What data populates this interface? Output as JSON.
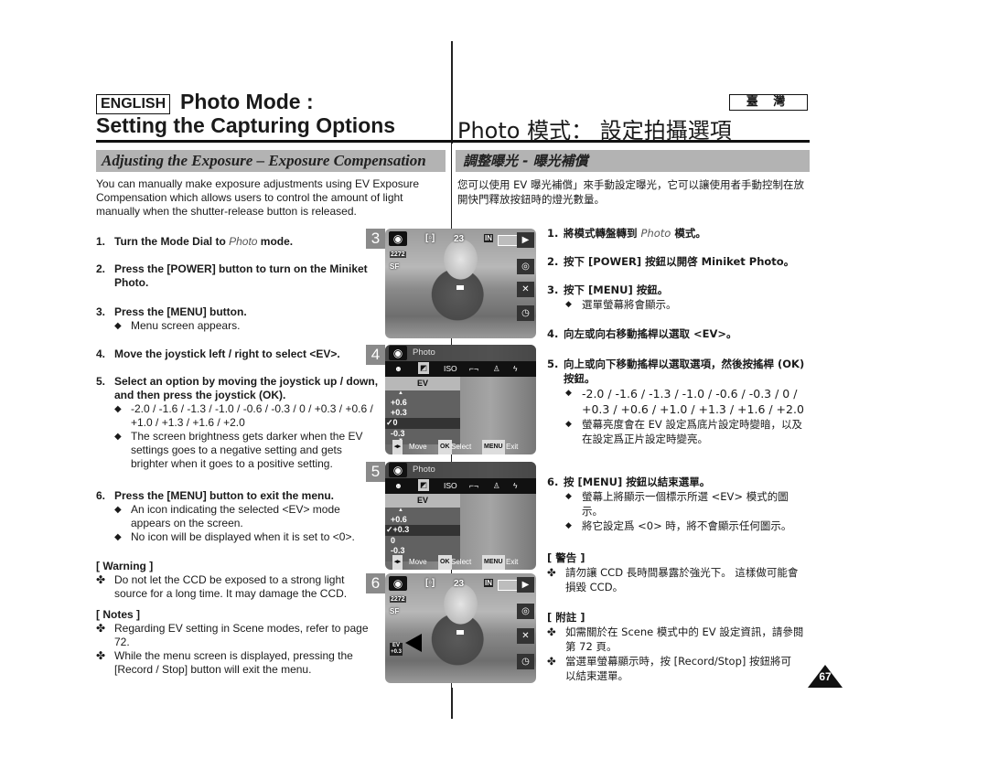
{
  "header": {
    "language_badge": "ENGLISH",
    "title_line1": "Photo Mode :",
    "title_line2": "Setting the Capturing Options",
    "region_badge": "臺 灣",
    "title_zh": "Photo  模式：  設定拍攝選項"
  },
  "section": {
    "title_en": "Adjusting the Exposure – Exposure Compensation",
    "title_zh": "調整曝光 - 曝光補償"
  },
  "english": {
    "intro": "You can manually make exposure adjustments using EV Exposure Compensation which allows users to control the amount of light manually when the shutter-release button is released.",
    "steps": [
      {
        "num": "1.",
        "text_pre": "Turn the Mode Dial to ",
        "text_italic": "Photo",
        "text_post": " mode."
      },
      {
        "num": "2.",
        "text": "Press the [POWER] button to turn on the Miniket Photo."
      },
      {
        "num": "3.",
        "text": "Press the [MENU] button.",
        "subs": [
          "Menu screen appears."
        ]
      },
      {
        "num": "4.",
        "text": "Move the joystick left / right to select <EV>."
      },
      {
        "num": "5.",
        "text": "Select an option by moving the joystick up / down, and then press the joystick (OK).",
        "subs": [
          "-2.0 / -1.6 / -1.3 / -1.0 / -0.6 / -0.3 / 0 / +0.3 / +0.6 / +1.0 / +1.3 / +1.6 / +2.0",
          "The screen brightness gets darker when the EV settings goes to a negative setting and gets brighter when it goes to a positive setting."
        ]
      },
      {
        "num": "6.",
        "text": "Press the [MENU] button to exit the menu.",
        "subs": [
          "An icon indicating the selected <EV> mode appears on the screen.",
          "No icon will be displayed when it is set to <0>."
        ]
      }
    ],
    "warning_title": "[ Warning ]",
    "warnings": [
      "Do not let the CCD be exposed to a strong light source for a long time. It may damage the CCD."
    ],
    "notes_title": "[ Notes ]",
    "notes": [
      "Regarding EV setting in Scene modes, refer to page 72.",
      "While the menu screen is displayed, pressing the [Record / Stop] button will exit the menu."
    ]
  },
  "chinese": {
    "intro": "您可以使用  EV 曝光補償」來手動設定曝光，它可以讓使用者手動控制在放開快門釋放按鈕時的燈光數量。",
    "steps": [
      {
        "num": "1.",
        "text_pre": "將模式轉盤轉到 ",
        "text_italic": "Photo",
        "text_post": " 模式。"
      },
      {
        "num": "2.",
        "text": "按下 [POWER] 按鈕以開啓 Miniket Photo。"
      },
      {
        "num": "3.",
        "text": "按下 [MENU] 按鈕。",
        "subs": [
          "選單螢幕將會顯示。"
        ]
      },
      {
        "num": "4.",
        "text": "向左或向右移動搖桿以選取 <EV>。"
      },
      {
        "num": "5.",
        "text": "向上或向下移動搖桿以選取選項，然後按搖桿 (OK) 按鈕。",
        "subs": [
          "-2.0 / -1.6 / -1.3 / -1.0 / -0.6 / -0.3 / 0 / +0.3 / +0.6 / +1.0 / +1.3 / +1.6 / +2.0",
          "螢幕亮度會在 EV 設定爲底片設定時變暗，以及在設定爲正片設定時變亮。"
        ]
      },
      {
        "num": "6.",
        "text": "按 [MENU] 按鈕以結束選單。",
        "subs": [
          "螢幕上將顯示一個標示所選 <EV> 模式的圖示。",
          "將它設定爲 <0> 時，將不會顯示任何圖示。"
        ]
      }
    ],
    "warning_title": "[ 警告 ]",
    "warnings": [
      "請勿讓 CCD 長時間暴露於強光下。 這樣做可能會損毀 CCD。"
    ],
    "notes_title": "[ 附註 ]",
    "notes": [
      "如需關於在 Scene 模式中的 EV 設定資訊，請參閱第 72 頁。",
      "當選單螢幕顯示時，按 [Record/Stop] 按鈕將可以結束選單。"
    ]
  },
  "screens": {
    "s3": {
      "step": "3",
      "counter": "23",
      "memory": "IN",
      "focus": "[▫]",
      "size": "2272",
      "quality": "SF"
    },
    "s4": {
      "step": "4",
      "menu_title": "Photo",
      "tabs": [
        "ISO"
      ],
      "ev_label": "EV",
      "options": [
        "+0.6",
        "+0.3",
        "0",
        "-0.3"
      ],
      "selected": "0",
      "footer": {
        "move_key": "◂▸",
        "move": "Move",
        "ok_key": "OK",
        "select": "Select",
        "menu_key": "MENU",
        "exit": "Exit"
      }
    },
    "s5": {
      "step": "5",
      "menu_title": "Photo",
      "tabs": [
        "ISO"
      ],
      "ev_label": "EV",
      "options": [
        "+0.6",
        "+0.3",
        "0",
        "-0.3"
      ],
      "selected": "+0.3",
      "footer": {
        "move_key": "◂▸",
        "move": "Move",
        "ok_key": "OK",
        "select": "Select",
        "menu_key": "MENU",
        "exit": "Exit"
      }
    },
    "s6": {
      "step": "6",
      "counter": "23",
      "memory": "IN",
      "focus": "[▫]",
      "size": "2272",
      "quality": "SF",
      "ev_badge": "EV +0.3"
    }
  },
  "page_number": "67"
}
